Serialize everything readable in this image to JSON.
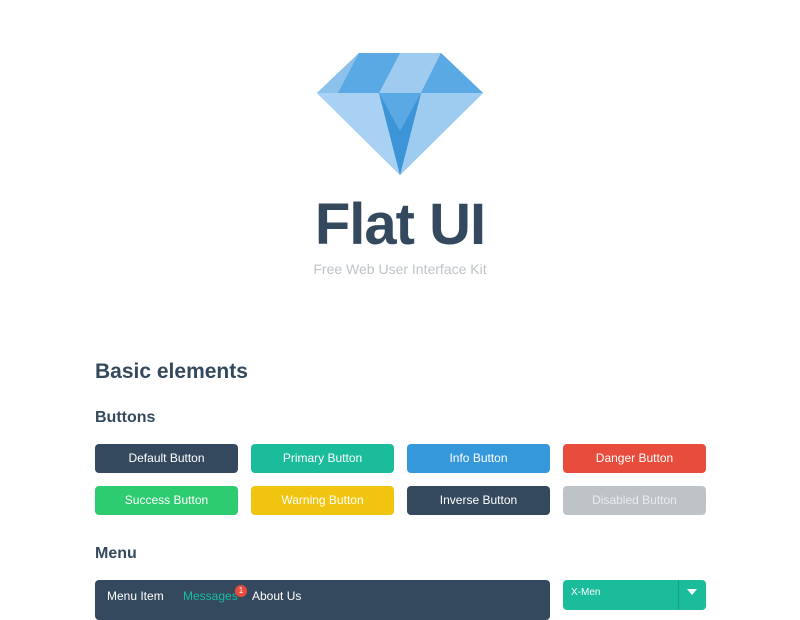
{
  "header": {
    "logo_icon": "diamond-icon",
    "title": "Flat UI",
    "subtitle": "Free Web User Interface Kit"
  },
  "sections": {
    "basic": "Basic elements",
    "buttons": "Buttons",
    "menu": "Menu"
  },
  "buttons": {
    "default": "Default Button",
    "primary": "Primary Button",
    "info": "Info Button",
    "danger": "Danger Button",
    "success": "Success Button",
    "warning": "Warning Button",
    "inverse": "Inverse Button",
    "disabled": "Disabled Button"
  },
  "menu": {
    "items": [
      "Menu Item",
      "Messages",
      "About Us"
    ],
    "active_index": 1,
    "badge": "1",
    "select_value": "X-Men",
    "select_icon": "caret-down-icon"
  },
  "colors": {
    "dark": "#34495e",
    "turquoise": "#1abc9c",
    "blue": "#3498db",
    "red": "#e74c3c",
    "green": "#2ecc71",
    "yellow": "#f1c40f",
    "silver": "#bdc3c7"
  }
}
